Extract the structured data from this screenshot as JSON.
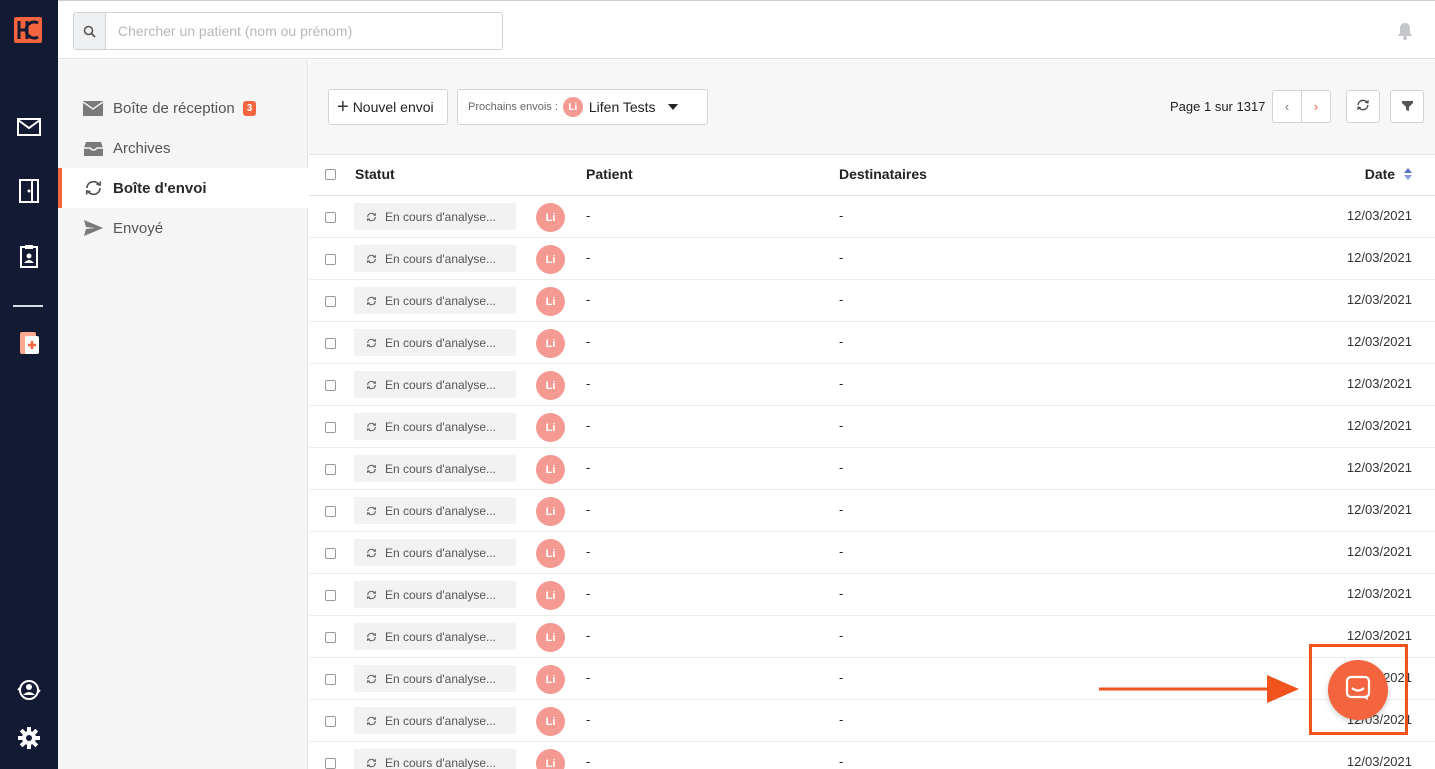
{
  "search": {
    "placeholder": "Chercher un patient (nom ou prénom)"
  },
  "sidebar": {
    "items": [
      {
        "label": "Boîte de réception",
        "badge": "3",
        "icon": "envelope-icon"
      },
      {
        "label": "Archives",
        "icon": "archive-tray-icon"
      },
      {
        "label": "Boîte d'envoi",
        "icon": "sync-icon",
        "active": true
      },
      {
        "label": "Envoyé",
        "icon": "paper-plane-icon"
      }
    ]
  },
  "toolbar": {
    "new_label": "Nouvel envoi",
    "next_label": "Prochains envois :",
    "next_avatar": "Li",
    "next_name": "Lifen Tests",
    "page_info": "Page 1 sur 1317",
    "prev": "‹",
    "next": "›"
  },
  "table": {
    "columns": {
      "status": "Statut",
      "patient": "Patient",
      "recipients": "Destinataires",
      "date": "Date"
    },
    "rows": [
      {
        "status": "En cours d'analyse...",
        "avatar": "Li",
        "patient": "-",
        "recipients": "-",
        "date": "12/03/2021"
      },
      {
        "status": "En cours d'analyse...",
        "avatar": "Li",
        "patient": "-",
        "recipients": "-",
        "date": "12/03/2021"
      },
      {
        "status": "En cours d'analyse...",
        "avatar": "Li",
        "patient": "-",
        "recipients": "-",
        "date": "12/03/2021"
      },
      {
        "status": "En cours d'analyse...",
        "avatar": "Li",
        "patient": "-",
        "recipients": "-",
        "date": "12/03/2021"
      },
      {
        "status": "En cours d'analyse...",
        "avatar": "Li",
        "patient": "-",
        "recipients": "-",
        "date": "12/03/2021"
      },
      {
        "status": "En cours d'analyse...",
        "avatar": "Li",
        "patient": "-",
        "recipients": "-",
        "date": "12/03/2021"
      },
      {
        "status": "En cours d'analyse...",
        "avatar": "Li",
        "patient": "-",
        "recipients": "-",
        "date": "12/03/2021"
      },
      {
        "status": "En cours d'analyse...",
        "avatar": "Li",
        "patient": "-",
        "recipients": "-",
        "date": "12/03/2021"
      },
      {
        "status": "En cours d'analyse...",
        "avatar": "Li",
        "patient": "-",
        "recipients": "-",
        "date": "12/03/2021"
      },
      {
        "status": "En cours d'analyse...",
        "avatar": "Li",
        "patient": "-",
        "recipients": "-",
        "date": "12/03/2021"
      },
      {
        "status": "En cours d'analyse...",
        "avatar": "Li",
        "patient": "-",
        "recipients": "-",
        "date": "12/03/2021"
      },
      {
        "status": "En cours d'analyse...",
        "avatar": "Li",
        "patient": "-",
        "recipients": "-",
        "date": "12/03/2021"
      },
      {
        "status": "En cours d'analyse...",
        "avatar": "Li",
        "patient": "-",
        "recipients": "-",
        "date": "12/03/2021"
      },
      {
        "status": "En cours d'analyse...",
        "avatar": "Li",
        "patient": "-",
        "recipients": "-",
        "date": "12/03/2021"
      }
    ]
  },
  "colors": {
    "accent": "#f4643f",
    "rail": "#131a33",
    "avatar": "#f49a92",
    "annotation": "#f0531c"
  }
}
